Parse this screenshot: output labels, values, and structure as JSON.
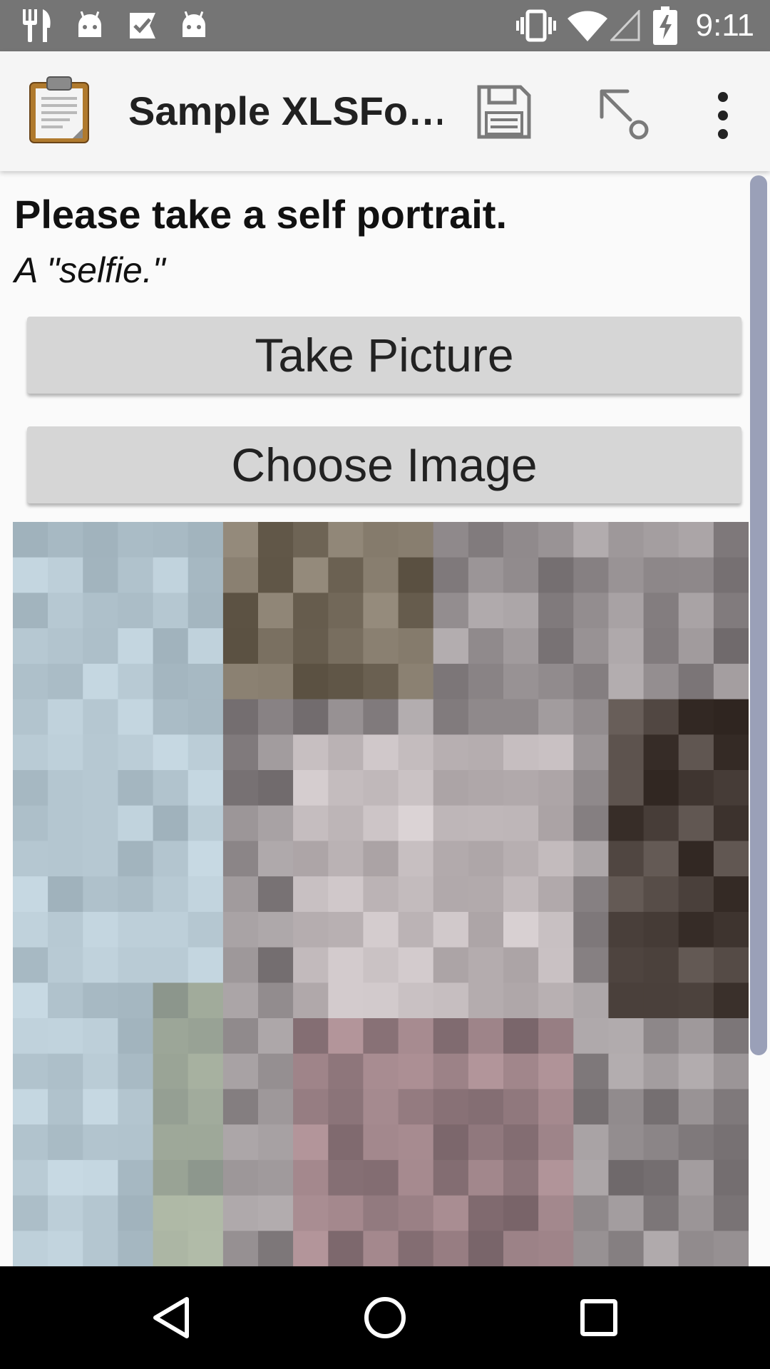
{
  "status_bar": {
    "time": "9:11",
    "icons": [
      "restaurant-icon",
      "android-icon",
      "checklist-icon",
      "android-icon",
      "vibrate-icon",
      "wifi-icon",
      "signal-icon",
      "battery-charging-icon"
    ]
  },
  "app_bar": {
    "title": "Sample XLSFo…",
    "icons": [
      "clipboard-icon",
      "save-icon",
      "go-to-icon",
      "overflow-menu-icon"
    ]
  },
  "question": {
    "label": "Please take a self portrait.",
    "hint": "A \"selfie.\""
  },
  "buttons": {
    "take_picture": "Take Picture",
    "choose_image": "Choose Image"
  },
  "image": {
    "description_icon": "pixelated-selfie-image"
  },
  "nav_bar": {
    "icons": [
      "back-icon",
      "home-icon",
      "recents-icon"
    ]
  },
  "colors": {
    "status_bar": "#757575",
    "app_bar": "#f5f5f5",
    "button": "#d6d6d6",
    "scrollbar": "#9aa0b8",
    "nav_bar": "#000000"
  }
}
